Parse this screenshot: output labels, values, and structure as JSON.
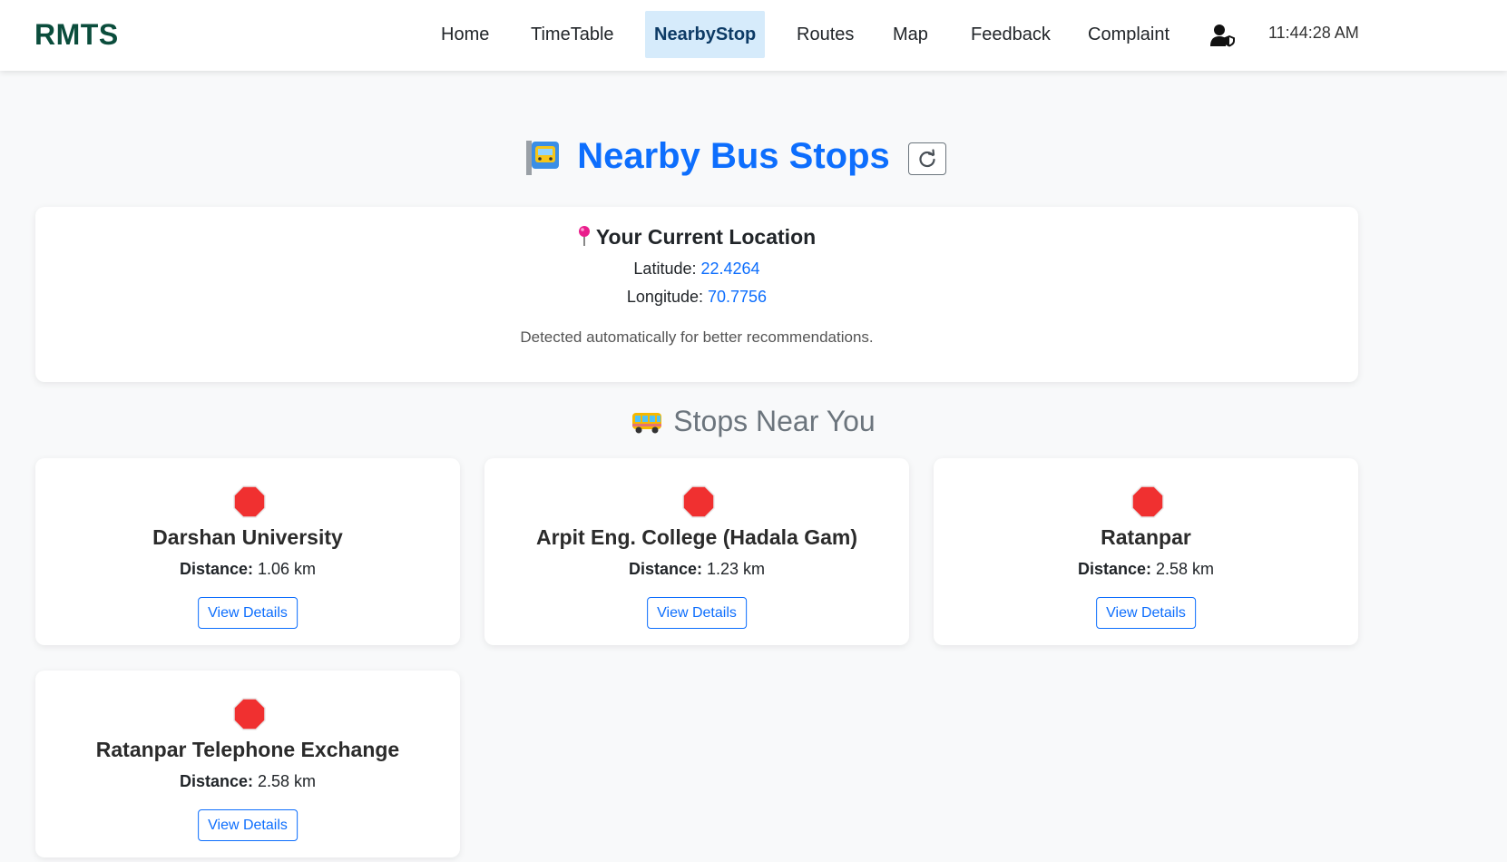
{
  "brand": "RMTS",
  "nav": {
    "home": "Home",
    "timetable": "TimeTable",
    "nearbystop": "NearbyStop",
    "routes": "Routes",
    "map": "Map",
    "feedback": "Feedback",
    "complaint": "Complaint"
  },
  "clock": "11:44:28 AM",
  "page_title": "Nearby Bus Stops",
  "location": {
    "heading": "Your Current Location",
    "latitude_label": "Latitude:",
    "latitude": "22.4264",
    "longitude_label": "Longitude:",
    "longitude": "70.7756",
    "note": "Detected automatically for better recommendations."
  },
  "section_title": "Stops Near You",
  "stops": [
    {
      "name": "Darshan University",
      "distance_label": "Distance:",
      "distance": "1.06 km",
      "button": "View Details"
    },
    {
      "name": "Arpit Eng. College (Hadala Gam)",
      "distance_label": "Distance:",
      "distance": "1.23 km",
      "button": "View Details"
    },
    {
      "name": "Ratanpar",
      "distance_label": "Distance:",
      "distance": "2.58 km",
      "button": "View Details"
    },
    {
      "name": "Ratanpar Telephone Exchange",
      "distance_label": "Distance:",
      "distance": "2.58 km",
      "button": "View Details"
    }
  ],
  "icons": {
    "user_shield": "user-shield-icon",
    "bus_stop": "bus-stop-icon",
    "refresh": "refresh-icon",
    "pin": "map-pin-icon",
    "bus": "bus-icon",
    "stop_sign": "stop-sign-icon"
  },
  "colors": {
    "brand": "#0b4d3c",
    "accent": "#0d6efd",
    "active_nav_bg": "#d6ebfb",
    "stop_sign": "#f03030"
  }
}
